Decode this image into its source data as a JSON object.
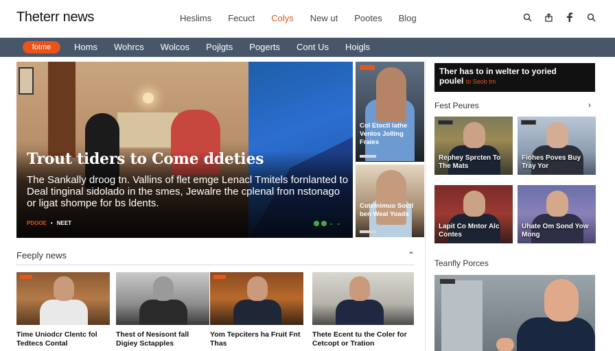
{
  "brand": "Theterr news",
  "top_nav": [
    {
      "label": "Heslims",
      "active": false
    },
    {
      "label": "Fecuct",
      "active": false
    },
    {
      "label": "Colys",
      "active": true
    },
    {
      "label": "New ut",
      "active": false
    },
    {
      "label": "Pootes",
      "active": false
    },
    {
      "label": "Blog",
      "active": false
    }
  ],
  "top_icons": [
    "search-icon",
    "share-icon",
    "facebook-icon",
    "search-icon"
  ],
  "nav": {
    "pill": "fotme",
    "items": [
      "Homs",
      "Wohrcs",
      "Wolcos",
      "Pojlgts",
      "Pogerts",
      "Cont Us",
      "Hoigls"
    ]
  },
  "hero": {
    "headline": "Trout tiders to Come ddeties",
    "summary": "The Sankally droog tn. Vallins of flet emge Lenacl Tmitels fornlanted to Deal tinginal sidolado in the smes, Jewalre the cplenal fron nstonago or ligat shompe for bs ldents.",
    "tag": "PDOOE",
    "meta": "NEET"
  },
  "side_cards": [
    {
      "caption": "Col Etoctl lathe Venlos Jolling Fraies"
    },
    {
      "caption": "Cotelnimuo Soctl ben Weal Yoads"
    }
  ],
  "ad": {
    "line1": "Ther has to in welter to yoried",
    "line2": "poulel",
    "highlight": "to Seob tm"
  },
  "fest": {
    "title": "Fest Peures",
    "cards": [
      {
        "caption": "Rephey Sprcten To The Mats"
      },
      {
        "caption": "Fiohes Poves Buy Tray Yor"
      },
      {
        "caption": "Lapit Co Mntor Alc Contes"
      },
      {
        "caption": "Uhate Om Sond Yow Mong"
      }
    ]
  },
  "teamly": {
    "title": "Teanfly Porces"
  },
  "reply": {
    "title": "Feeply news",
    "cards": [
      {
        "caption": "Time Uniodcr Clentc fol Tedtecs Contal"
      },
      {
        "caption": "Thest of Nesisont fall Digiey Sctapples"
      },
      {
        "caption": "Yom Tepciters ha Fruit Fnt Thas"
      },
      {
        "caption": "Thete Ecent tu the Coler for Cetcopt or Tration"
      }
    ]
  },
  "colors": {
    "accent": "#e2571c",
    "navbar": "#475669"
  }
}
